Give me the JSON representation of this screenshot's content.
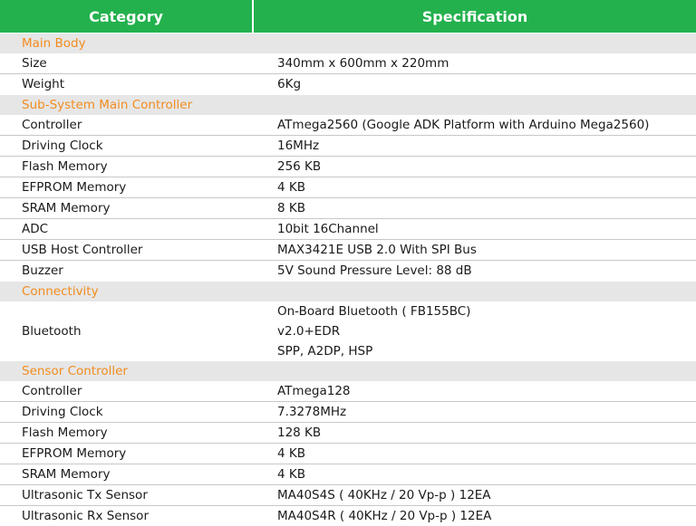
{
  "header": {
    "category": "Category",
    "specification": "Specification"
  },
  "sections": [
    {
      "title": "Main Body",
      "rows": [
        {
          "label": "Size",
          "values": [
            "340mm x 600mm x 220mm"
          ]
        },
        {
          "label": "Weight",
          "values": [
            "6Kg"
          ]
        }
      ]
    },
    {
      "title": "Sub-System Main Controller",
      "rows": [
        {
          "label": "Controller",
          "values": [
            "ATmega2560 (Google ADK Platform with Arduino Mega2560)"
          ]
        },
        {
          "label": "Driving Clock",
          "values": [
            "16MHz"
          ]
        },
        {
          "label": "Flash Memory",
          "values": [
            "256 KB"
          ]
        },
        {
          "label": "EFPROM Memory",
          "values": [
            "4 KB"
          ]
        },
        {
          "label": "SRAM Memory",
          "values": [
            "8 KB"
          ]
        },
        {
          "label": "ADC",
          "values": [
            "10bit 16Channel"
          ]
        },
        {
          "label": "USB Host Controller",
          "values": [
            "MAX3421E USB 2.0 With SPI Bus"
          ]
        },
        {
          "label": "Buzzer",
          "values": [
            "5V Sound Pressure Level: 88 dB"
          ]
        }
      ]
    },
    {
      "title": "Connectivity",
      "rows": [
        {
          "label": "Bluetooth",
          "values": [
            "On-Board Bluetooth ( FB155BC)",
            "v2.0+EDR",
            "SPP, A2DP, HSP"
          ]
        }
      ]
    },
    {
      "title": "Sensor Controller",
      "rows": [
        {
          "label": "Controller",
          "values": [
            "ATmega128"
          ]
        },
        {
          "label": "Driving Clock",
          "values": [
            "7.3278MHz"
          ]
        },
        {
          "label": "Flash Memory",
          "values": [
            "128 KB"
          ]
        },
        {
          "label": "EFPROM Memory",
          "values": [
            "4 KB"
          ]
        },
        {
          "label": "SRAM Memory",
          "values": [
            "4 KB"
          ]
        },
        {
          "label": "Ultrasonic Tx Sensor",
          "values": [
            "MA40S4S ( 40KHz / 20 Vp-p ) 12EA"
          ]
        },
        {
          "label": "Ultrasonic Rx Sensor",
          "values": [
            "MA40S4R ( 40KHz / 20 Vp-p ) 12EA"
          ]
        }
      ]
    }
  ],
  "colors": {
    "header_bg": "#23b14d",
    "section_bg": "#e6e6e6",
    "section_text": "#f28c1e"
  }
}
